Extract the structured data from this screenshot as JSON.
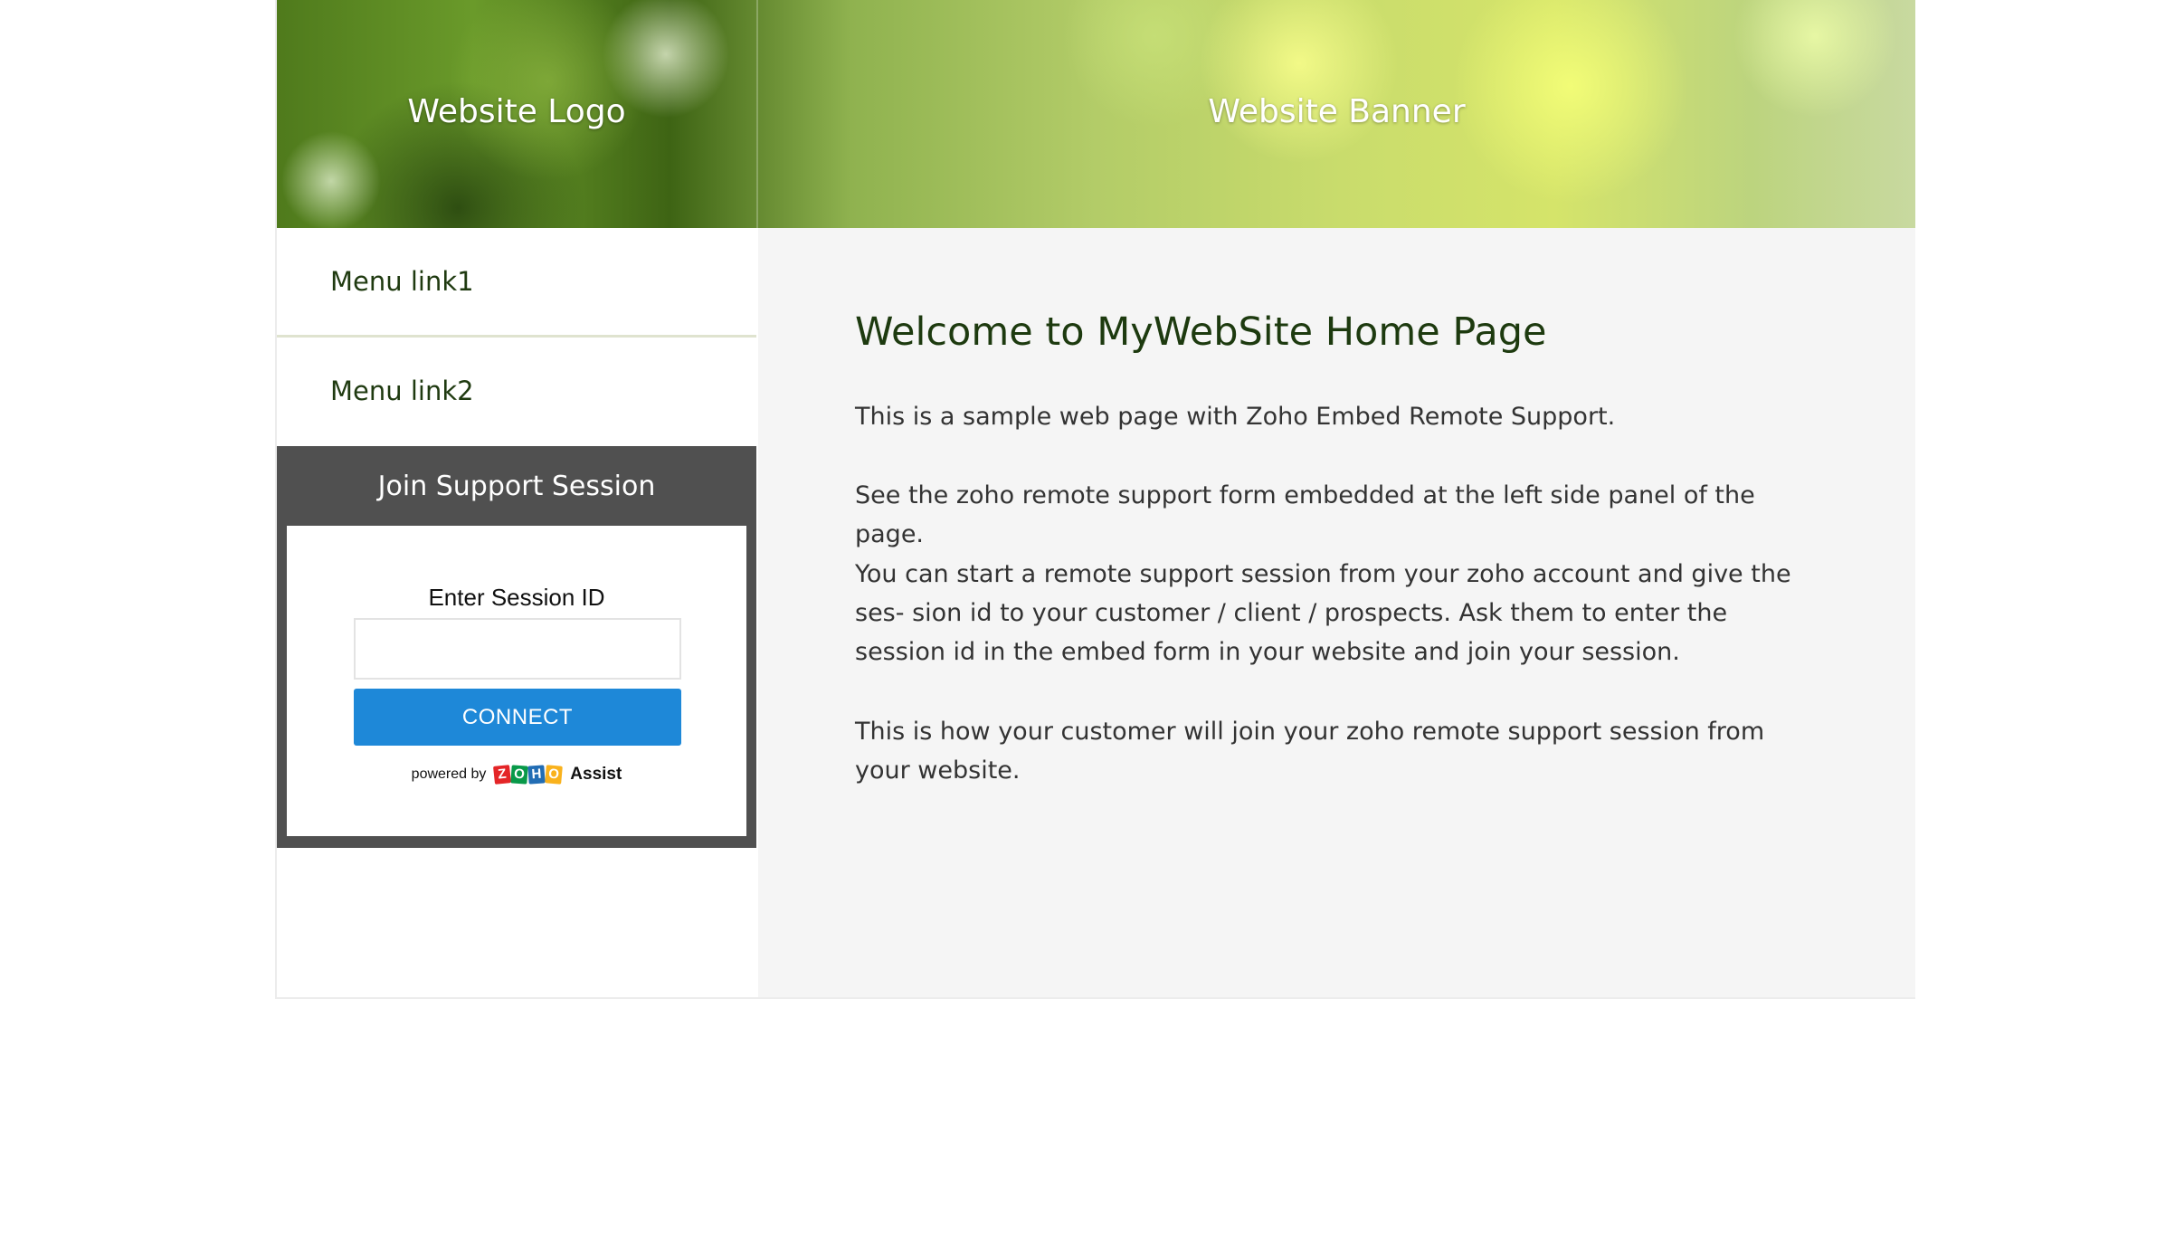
{
  "header": {
    "logo": "Website Logo",
    "banner": "Website Banner"
  },
  "sidebar": {
    "menu": [
      {
        "label": "Menu link1"
      },
      {
        "label": "Menu link2"
      }
    ]
  },
  "support_widget": {
    "title": "Join Support Session",
    "session_label": "Enter Session ID",
    "session_input_value": "",
    "connect_label": "CONNECT",
    "powered_by": "powered by",
    "brand_letters": [
      "Z",
      "O",
      "H",
      "O"
    ],
    "brand_product": "Assist"
  },
  "main": {
    "title": "Welcome to MyWebSite Home Page",
    "paragraphs": [
      "This is a sample web page with Zoho Embed Remote Support.",
      "See the zoho remote support form embedded at the left side panel of the page.",
      "You can start a remote support session from your zoho account and give the ses- sion id to your customer / client / prospects. Ask them to enter the session id in the embed form in your website and join your session.",
      "This is how your customer will join your zoho remote support session from your website."
    ]
  },
  "colors": {
    "connect_button": "#1e88d8",
    "support_header": "#505050",
    "title_text": "#1d3a0f",
    "content_bg": "#f5f5f5",
    "zoho_z": "#e42527",
    "zoho_o1": "#089949",
    "zoho_h": "#226db4",
    "zoho_o2": "#f9b21d"
  }
}
